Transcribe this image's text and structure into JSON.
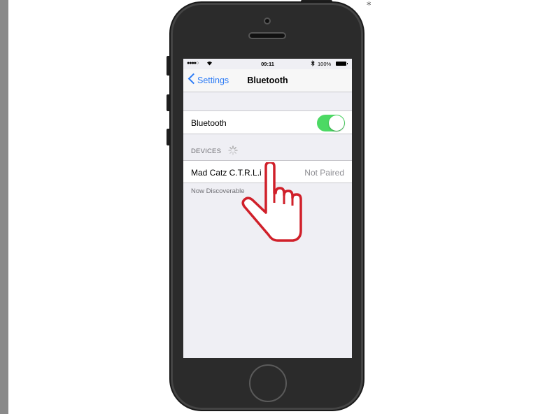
{
  "status_bar": {
    "signal": "●●●●○",
    "time": "09:11",
    "battery": "100%"
  },
  "nav": {
    "back_label": "Settings",
    "title": "Bluetooth"
  },
  "bluetooth_cell": {
    "label": "Bluetooth",
    "toggle_on": true,
    "toggle_color": "#4cd964"
  },
  "devices": {
    "header": "DEVICES",
    "items": [
      {
        "name": "Mad Catz C.T.R.L.i",
        "status": "Not Paired"
      }
    ],
    "footer": "Now Discoverable"
  },
  "annotation": {
    "corner_mark": "*",
    "hand_color": "#d0202a"
  }
}
